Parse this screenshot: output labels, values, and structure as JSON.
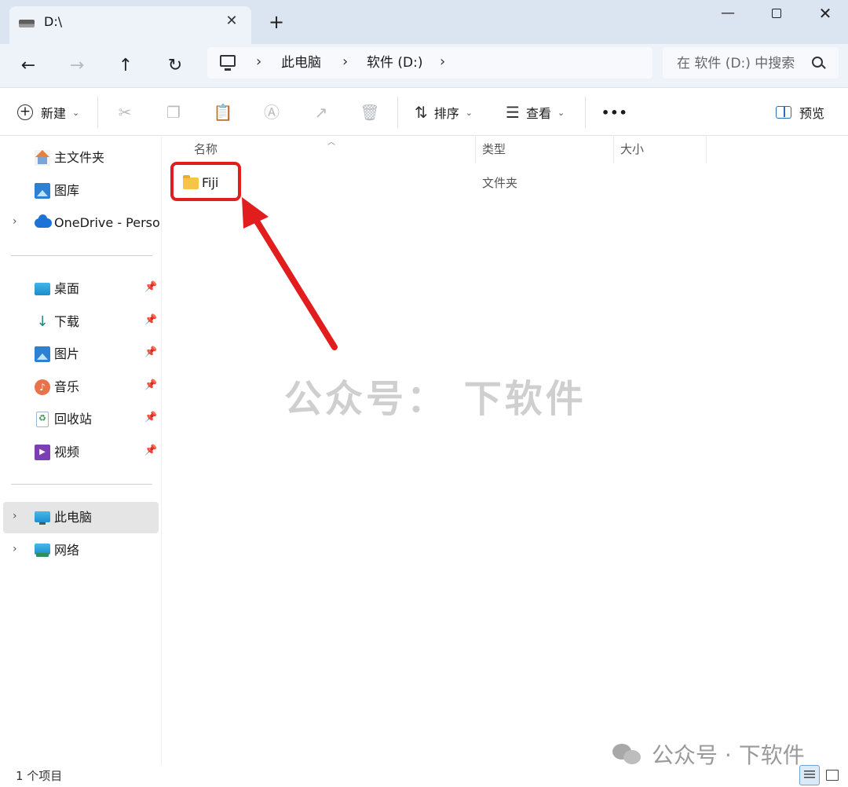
{
  "window": {
    "tab_title": "D:\\",
    "tab_close": "✕",
    "new_tab": "+",
    "minimize": "—",
    "close": "✕"
  },
  "nav": {
    "back": "←",
    "forward": "→",
    "up": "↑",
    "refresh": "↻",
    "breadcrumb": [
      "此电脑",
      "软件 (D:)"
    ],
    "search_placeholder": "在 软件 (D:) 中搜索"
  },
  "toolbar": {
    "new_label": "新建",
    "sort_label": "排序",
    "view_label": "查看",
    "more": "•••",
    "preview_label": "预览",
    "icons": [
      "cut-icon",
      "copy-icon",
      "paste-icon",
      "rename-icon",
      "share-icon",
      "delete-icon"
    ]
  },
  "sidebar": {
    "quick": [
      {
        "label": "主文件夹",
        "icon": "home-icon"
      },
      {
        "label": "图库",
        "icon": "gallery-icon"
      },
      {
        "label": "OneDrive - Personal",
        "icon": "onedrive-icon"
      }
    ],
    "pinned": [
      {
        "label": "桌面",
        "icon": "desktop-icon"
      },
      {
        "label": "下载",
        "icon": "download-icon"
      },
      {
        "label": "图片",
        "icon": "pictures-icon"
      },
      {
        "label": "音乐",
        "icon": "music-icon"
      },
      {
        "label": "回收站",
        "icon": "recycle-bin-icon"
      },
      {
        "label": "视频",
        "icon": "videos-icon"
      }
    ],
    "devices": [
      {
        "label": "此电脑",
        "icon": "this-pc-icon",
        "selected": true
      },
      {
        "label": "网络",
        "icon": "network-icon"
      }
    ]
  },
  "content": {
    "columns": {
      "name": "名称",
      "type": "类型",
      "size": "大小"
    },
    "files": [
      {
        "name": "Fiji",
        "type": "文件夹",
        "size": ""
      }
    ]
  },
  "status": {
    "item_count": "1 个项目"
  },
  "watermark": {
    "center": "公众号： 下软件",
    "corner": "公众号 · 下软件"
  },
  "annotation": {
    "color": "#e11d1d"
  }
}
